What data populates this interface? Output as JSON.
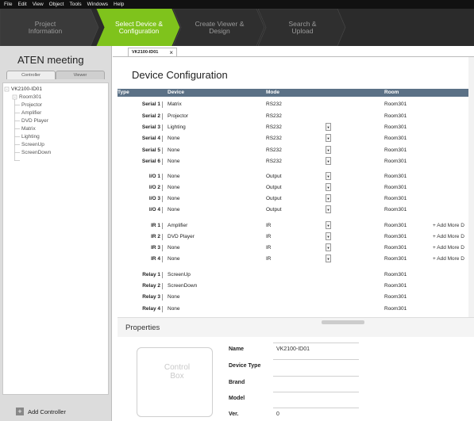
{
  "menu": [
    "File",
    "Edit",
    "View",
    "Object",
    "Tools",
    "Windows",
    "Help"
  ],
  "steps": [
    {
      "line1": "Project",
      "line2": "Information",
      "active": false
    },
    {
      "line1": "Select Device &",
      "line2": "Configuration",
      "active": true
    },
    {
      "line1": "Create Viewer &",
      "line2": "Design",
      "active": false
    },
    {
      "line1": "Search &",
      "line2": "Upload",
      "active": false
    }
  ],
  "colors": {
    "accent": "#7fc31c",
    "header": "#5b7186",
    "menubar": "#111111",
    "stepbar": "#2b2b2b"
  },
  "left": {
    "title": "ATEN meeting",
    "tabs": [
      "Controller",
      "Viewer"
    ],
    "tree": [
      "VK2100-ID01",
      "Room301",
      "Projector",
      "Amplifier",
      "DVD Player",
      "Matrix",
      "Lighting",
      "ScreenUp",
      "ScreenDown"
    ],
    "add_controller": "Add Controller"
  },
  "doc_tab": {
    "label": "VK2100-ID01",
    "close": "×"
  },
  "device_config": {
    "title": "Device Configuration",
    "columns": {
      "type": "Type",
      "device": "Device",
      "mode": "Mode",
      "room": "Room"
    },
    "rows": [
      {
        "label": "Serial 1",
        "device": "Matrix",
        "mode": "RS232",
        "room": "Room301",
        "dd": false,
        "add": ""
      },
      {
        "label": "Serial 2",
        "device": "Projector",
        "mode": "RS232",
        "room": "Room301",
        "dd": false,
        "add": ""
      },
      {
        "label": "Serial 3",
        "device": "Lighting",
        "mode": "RS232",
        "room": "Room301",
        "dd": true,
        "add": ""
      },
      {
        "label": "Serial 4",
        "device": "None",
        "mode": "RS232",
        "room": "Room301",
        "dd": true,
        "add": ""
      },
      {
        "label": "Serial 5",
        "device": "None",
        "mode": "RS232",
        "room": "Room301",
        "dd": true,
        "add": ""
      },
      {
        "label": "Serial 6",
        "device": "None",
        "mode": "RS232",
        "room": "Room301",
        "dd": true,
        "add": ""
      },
      {
        "label": "I/O 1",
        "device": "None",
        "mode": "Output",
        "room": "Room301",
        "dd": true,
        "add": ""
      },
      {
        "label": "I/O 2",
        "device": "None",
        "mode": "Output",
        "room": "Room301",
        "dd": true,
        "add": ""
      },
      {
        "label": "I/O 3",
        "device": "None",
        "mode": "Output",
        "room": "Room301",
        "dd": true,
        "add": ""
      },
      {
        "label": "I/O 4",
        "device": "None",
        "mode": "Output",
        "room": "Room301",
        "dd": true,
        "add": ""
      },
      {
        "label": "IR 1",
        "device": "Amplifier",
        "mode": "IR",
        "room": "Room301",
        "dd": true,
        "add": "+ Add More D"
      },
      {
        "label": "IR 2",
        "device": "DVD Player",
        "mode": "IR",
        "room": "Room301",
        "dd": true,
        "add": "+ Add More D"
      },
      {
        "label": "IR 3",
        "device": "None",
        "mode": "IR",
        "room": "Room301",
        "dd": true,
        "add": "+ Add More D"
      },
      {
        "label": "IR 4",
        "device": "None",
        "mode": "IR",
        "room": "Room301",
        "dd": true,
        "add": "+ Add More D"
      },
      {
        "label": "Relay 1",
        "device": "ScreenUp",
        "mode": "",
        "room": "Room301",
        "dd": false,
        "add": ""
      },
      {
        "label": "Relay 2",
        "device": "ScreenDown",
        "mode": "",
        "room": "Room301",
        "dd": false,
        "add": ""
      },
      {
        "label": "Relay 3",
        "device": "None",
        "mode": "",
        "room": "Room301",
        "dd": false,
        "add": ""
      },
      {
        "label": "Relay 4",
        "device": "None",
        "mode": "",
        "room": "Room301",
        "dd": false,
        "add": ""
      }
    ]
  },
  "properties": {
    "title": "Properties",
    "control_box": "Control Box",
    "fields": [
      {
        "label": "Name",
        "value": "VK2100-ID01"
      },
      {
        "label": "Device Type",
        "value": ""
      },
      {
        "label": "Brand",
        "value": ""
      },
      {
        "label": "Model",
        "value": ""
      },
      {
        "label": "Ver.",
        "value": "0"
      }
    ]
  }
}
